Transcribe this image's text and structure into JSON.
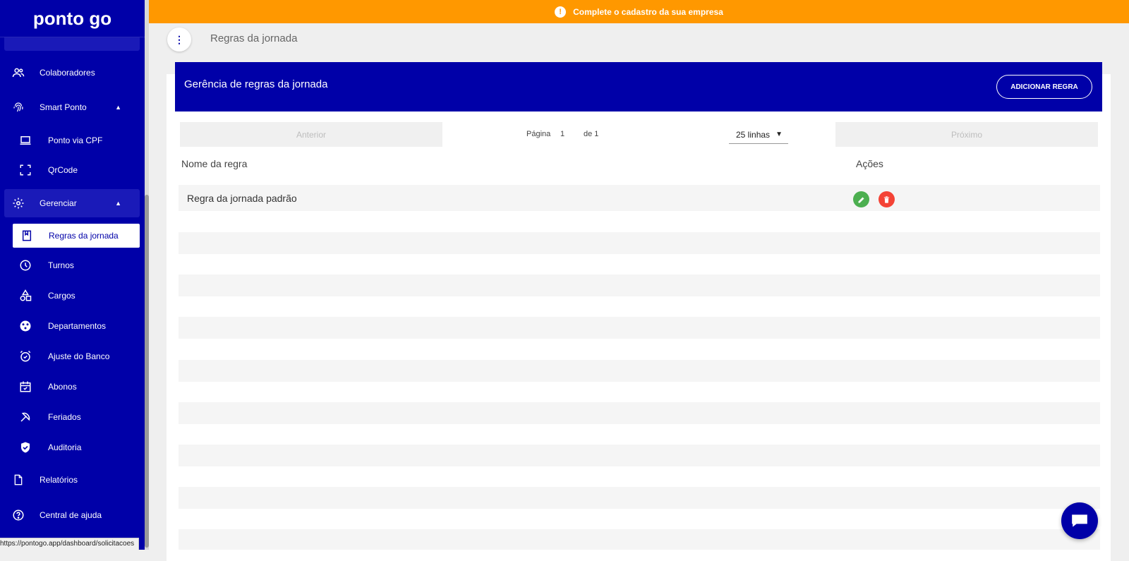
{
  "app": {
    "logo_text": "ponto go"
  },
  "banner": {
    "text": "Complete o cadastro da sua empresa"
  },
  "sidebar": {
    "items": [
      {
        "label": "Colaboradores",
        "icon": "people-icon"
      },
      {
        "label": "Smart Ponto",
        "icon": "fingerprint-icon",
        "expanded": true
      },
      {
        "label": "Ponto via CPF",
        "icon": "laptop-icon"
      },
      {
        "label": "QrCode",
        "icon": "scan-icon"
      },
      {
        "label": "Gerenciar",
        "icon": "gear-icon",
        "expanded": true
      },
      {
        "label": "Regras da jornada",
        "icon": "book-icon",
        "selected": true
      },
      {
        "label": "Turnos",
        "icon": "clock-icon"
      },
      {
        "label": "Cargos",
        "icon": "shapes-icon"
      },
      {
        "label": "Departamentos",
        "icon": "group-icon"
      },
      {
        "label": "Ajuste do Banco",
        "icon": "alarm-icon"
      },
      {
        "label": "Abonos",
        "icon": "calendar-check-icon"
      },
      {
        "label": "Feriados",
        "icon": "beach-icon"
      },
      {
        "label": "Auditoria",
        "icon": "shield-check-icon"
      },
      {
        "label": "Relatórios",
        "icon": "document-icon"
      },
      {
        "label": "Central de ajuda",
        "icon": "help-icon"
      }
    ]
  },
  "status_url": "https://pontogo.app/dashboard/solicitacoes",
  "header": {
    "title": "Regras da jornada"
  },
  "card": {
    "title": "Gerência de regras da jornada",
    "add_button": "ADICIONAR REGRA"
  },
  "pager": {
    "prev": "Anterior",
    "next": "Próximo",
    "page_label": "Página",
    "page": "1",
    "of_label": "de 1",
    "rows": "25 linhas"
  },
  "table": {
    "columns": [
      "Nome da regra",
      "Ações"
    ],
    "rows": [
      {
        "name": "Regra da jornada padrão"
      }
    ]
  },
  "colors": {
    "primary": "#0000a8",
    "banner": "#ff9800",
    "edit": "#4caf50",
    "delete": "#f44336"
  }
}
